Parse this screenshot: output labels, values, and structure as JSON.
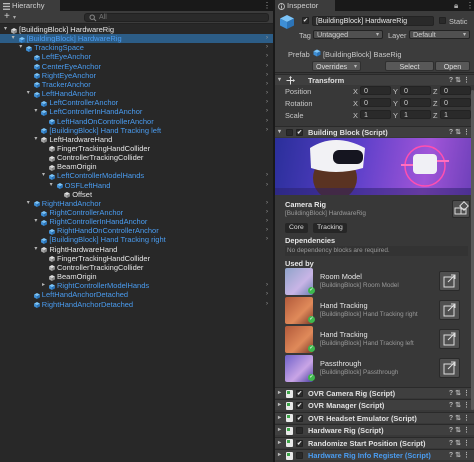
{
  "hierarchy": {
    "tab_label": "Hierarchy",
    "add_button": "+",
    "search_scope": "All",
    "rows": [
      {
        "text": "[BuildingBlock] HardwareRig",
        "indent": 0,
        "arrow": "down",
        "white": true,
        "sel": false
      },
      {
        "text": "[BuildingBlock] HardwareRig",
        "indent": 1,
        "arrow": "down",
        "white": false,
        "sel": true
      },
      {
        "text": "TrackingSpace",
        "indent": 2,
        "arrow": "down",
        "white": false,
        "sel": false
      },
      {
        "text": "LeftEyeAnchor",
        "indent": 3,
        "arrow": "",
        "white": false,
        "sel": false
      },
      {
        "text": "CenterEyeAnchor",
        "indent": 3,
        "arrow": "",
        "white": false,
        "sel": false
      },
      {
        "text": "RightEyeAnchor",
        "indent": 3,
        "arrow": "",
        "white": false,
        "sel": false
      },
      {
        "text": "TrackerAnchor",
        "indent": 3,
        "arrow": "",
        "white": false,
        "sel": false
      },
      {
        "text": "LeftHandAnchor",
        "indent": 3,
        "arrow": "down",
        "white": false,
        "sel": false
      },
      {
        "text": "LeftControllerAnchor",
        "indent": 4,
        "arrow": "",
        "white": false,
        "sel": false
      },
      {
        "text": "LeftControllerInHandAnchor",
        "indent": 4,
        "arrow": "down",
        "white": false,
        "sel": false
      },
      {
        "text": "LeftHandOnControllerAnchor",
        "indent": 5,
        "arrow": "",
        "white": false,
        "sel": false
      },
      {
        "text": "[BuildingBlock] Hand Tracking left",
        "indent": 4,
        "arrow": "",
        "white": false,
        "sel": false
      },
      {
        "text": "LeftHardwareHand",
        "indent": 4,
        "arrow": "down",
        "white": true,
        "sel": false
      },
      {
        "text": "FingerTrackingHandCollider",
        "indent": 5,
        "arrow": "",
        "white": true,
        "sel": false
      },
      {
        "text": "ControllerTrackingCollider",
        "indent": 5,
        "arrow": "",
        "white": true,
        "sel": false
      },
      {
        "text": "BeamOrigin",
        "indent": 5,
        "arrow": "",
        "white": true,
        "sel": false
      },
      {
        "text": "LeftControllerModelHands",
        "indent": 5,
        "arrow": "down",
        "white": false,
        "sel": false
      },
      {
        "text": "OSFLeftHand",
        "indent": 6,
        "arrow": "down",
        "white": false,
        "sel": false
      },
      {
        "text": "Offset",
        "indent": 7,
        "arrow": "",
        "white": true,
        "sel": false
      },
      {
        "text": "RightHandAnchor",
        "indent": 3,
        "arrow": "down",
        "white": false,
        "sel": false
      },
      {
        "text": "RightControllerAnchor",
        "indent": 4,
        "arrow": "",
        "white": false,
        "sel": false
      },
      {
        "text": "RightControllerInHandAnchor",
        "indent": 4,
        "arrow": "down",
        "white": false,
        "sel": false
      },
      {
        "text": "RightHandOnControllerAnchor",
        "indent": 5,
        "arrow": "",
        "white": false,
        "sel": false
      },
      {
        "text": "[BuildingBlock] Hand Tracking right",
        "indent": 4,
        "arrow": "",
        "white": false,
        "sel": false
      },
      {
        "text": "RightHardwareHand",
        "indent": 4,
        "arrow": "down",
        "white": true,
        "sel": false
      },
      {
        "text": "FingerTrackingHandCollider",
        "indent": 5,
        "arrow": "",
        "white": true,
        "sel": false
      },
      {
        "text": "ControllerTrackingCollider",
        "indent": 5,
        "arrow": "",
        "white": true,
        "sel": false
      },
      {
        "text": "BeamOrigin",
        "indent": 5,
        "arrow": "",
        "white": true,
        "sel": false
      },
      {
        "text": "RightControllerModelHands",
        "indent": 5,
        "arrow": "right",
        "white": false,
        "sel": false
      },
      {
        "text": "LeftHandAnchorDetached",
        "indent": 3,
        "arrow": "",
        "white": false,
        "sel": false
      },
      {
        "text": "RightHandAnchorDetached",
        "indent": 3,
        "arrow": "",
        "white": false,
        "sel": false
      }
    ]
  },
  "inspector": {
    "tab_label": "Inspector",
    "object_name": "[BuildingBlock] HardwareRig",
    "static_label": "Static",
    "tag_label": "Tag",
    "tag_value": "Untagged",
    "layer_label": "Layer",
    "layer_value": "Default",
    "prefab_label": "Prefab",
    "prefab_value": "[BuildingBlock] BaseRig",
    "overrides_label": "Overrides",
    "select_label": "Select",
    "open_label": "Open",
    "transform": {
      "title": "Transform",
      "rows": [
        {
          "label": "Position",
          "x": "0",
          "y": "0",
          "z": "0"
        },
        {
          "label": "Rotation",
          "x": "0",
          "y": "0",
          "z": "0"
        },
        {
          "label": "Scale",
          "x": "1",
          "y": "1",
          "z": "1"
        }
      ]
    },
    "building_block": {
      "title": "Building Block (Script)",
      "block_name": "Camera Rig",
      "block_instance": "[BuildingBlock] HardwareRig",
      "tags": [
        "Core",
        "Tracking"
      ],
      "dependencies_title": "Dependencies",
      "dependencies_note": "No dependency blocks are required.",
      "used_by_title": "Used by",
      "used_by": [
        {
          "title": "Room Model",
          "sub": "[BuildingBlock] Room Model"
        },
        {
          "title": "Hand Tracking",
          "sub": "[BuildingBlock] Hand Tracking right"
        },
        {
          "title": "Hand Tracking",
          "sub": "[BuildingBlock] Hand Tracking left"
        },
        {
          "title": "Passthrough",
          "sub": "[BuildingBlock] Passthrough"
        }
      ]
    },
    "scripts": [
      {
        "name": "OVR Camera Rig (Script)",
        "checked": true,
        "link": false
      },
      {
        "name": "OVR Manager (Script)",
        "checked": true,
        "link": false
      },
      {
        "name": "OVR Headset Emulator (Script)",
        "checked": true,
        "link": false
      },
      {
        "name": "Hardware Rig (Script)",
        "checked": false,
        "link": false
      },
      {
        "name": "Randomize Start Position (Script)",
        "checked": true,
        "link": false
      },
      {
        "name": "Hardware Rig Info Register (Script)",
        "checked": false,
        "link": true
      }
    ]
  },
  "colors": {
    "accent": "#4a9cf0",
    "selection": "#2c5d87",
    "panel": "#383838",
    "hierarchy_bg": "#282828"
  }
}
